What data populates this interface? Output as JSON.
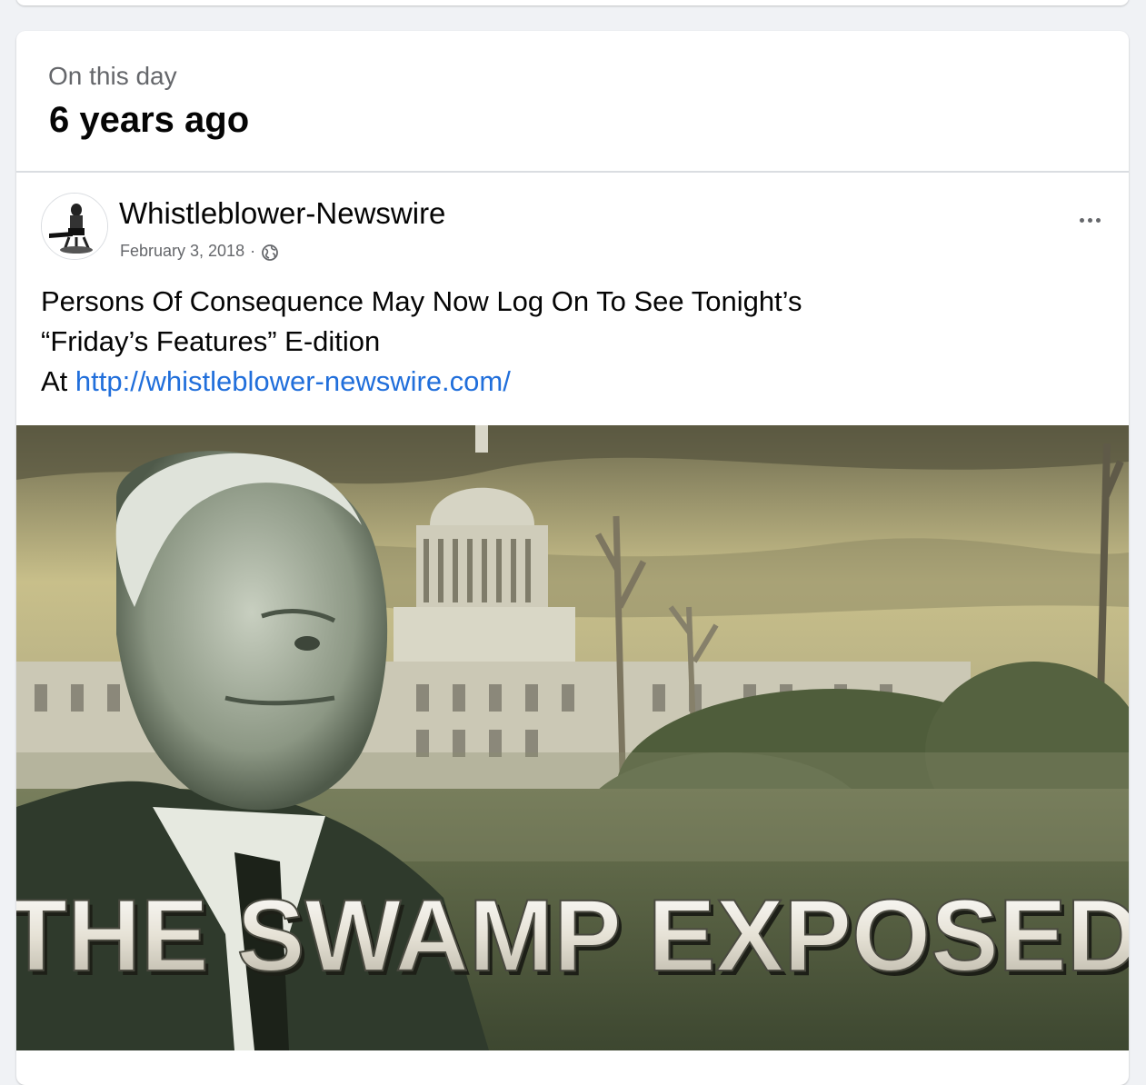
{
  "memory": {
    "kicker": "On this day",
    "title": "6 years ago"
  },
  "post": {
    "author": "Whistleblower-Newswire",
    "date": "February 3, 2018",
    "separator": "·",
    "privacy_icon": "globe-icon",
    "more_icon": "more-options-icon",
    "text_line1": "Persons Of Consequence May Now Log On To See Tonight’s",
    "text_line2": "“Friday’s Features” E-dition",
    "text_line3_prefix": "At ",
    "link": "http://whistleblower-newswire.com/",
    "image": {
      "caption": "THE SWAMP EXPOSED"
    }
  },
  "colors": {
    "link": "#216fdb",
    "secondary_text": "#65676b",
    "primary_text": "#050505"
  }
}
